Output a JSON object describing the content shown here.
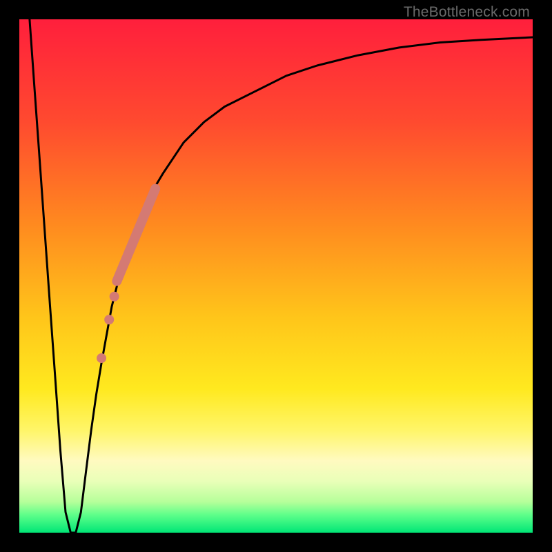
{
  "watermark": "TheBottleneck.com",
  "chart_data": {
    "type": "line",
    "title": "",
    "xlabel": "",
    "ylabel": "",
    "xlim": [
      0,
      100
    ],
    "ylim": [
      0,
      100
    ],
    "gradient_stops": [
      {
        "offset": 0.0,
        "color": "#ff1f3c"
      },
      {
        "offset": 0.2,
        "color": "#ff4a2f"
      },
      {
        "offset": 0.4,
        "color": "#ff8a1f"
      },
      {
        "offset": 0.58,
        "color": "#ffc51a"
      },
      {
        "offset": 0.72,
        "color": "#ffe91f"
      },
      {
        "offset": 0.8,
        "color": "#fff568"
      },
      {
        "offset": 0.86,
        "color": "#fffac0"
      },
      {
        "offset": 0.9,
        "color": "#e9ffb8"
      },
      {
        "offset": 0.94,
        "color": "#b6ff9a"
      },
      {
        "offset": 0.965,
        "color": "#5fff8a"
      },
      {
        "offset": 1.0,
        "color": "#00e676"
      }
    ],
    "series": [
      {
        "name": "bottleneck-curve",
        "color": "#000000",
        "x": [
          2,
          3,
          4,
          5,
          6,
          7,
          8,
          9,
          10,
          11,
          12,
          13,
          14,
          15,
          16,
          18,
          20,
          22,
          25,
          28,
          32,
          36,
          40,
          46,
          52,
          58,
          66,
          74,
          82,
          90,
          100
        ],
        "y": [
          100,
          86,
          72,
          58,
          44,
          30,
          16,
          4,
          0,
          0,
          4,
          12,
          20,
          27,
          33,
          44,
          52,
          58,
          65,
          70,
          76,
          80,
          83,
          86,
          89,
          91,
          93,
          94.5,
          95.5,
          96,
          96.5
        ]
      }
    ],
    "highlight_segment": {
      "color": "#d47a73",
      "x": [
        19,
        26.5
      ],
      "y": [
        49,
        67
      ]
    },
    "highlight_points": {
      "color": "#d47a73",
      "points": [
        {
          "x": 18.5,
          "y": 46
        },
        {
          "x": 17.5,
          "y": 41.5
        },
        {
          "x": 16.0,
          "y": 34
        }
      ]
    }
  }
}
